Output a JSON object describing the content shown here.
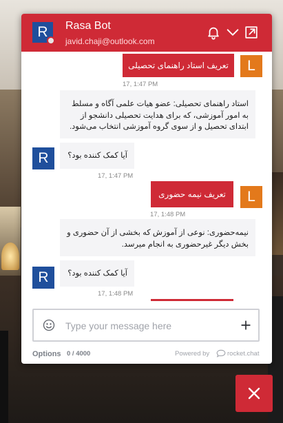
{
  "header": {
    "avatar_letter": "R",
    "title": "Rasa Bot",
    "subtitle": "javid.chaji@outlook.com"
  },
  "messages": [
    {
      "sender": "user",
      "avatar_letter": "L",
      "text": "تعریف استاد راهنمای تحصیلی",
      "time": "17, 1:47 PM"
    },
    {
      "sender": "bot",
      "text": "استاد راهنمای تحصیلی: عضو هیات علمی آگاه و مسلط به امور آموزشی، که برای هدایت تحصیلی دانشجو از ابتدای تحصیل و از سوی گروه آموزشی انتخاب می‌شود."
    },
    {
      "sender": "bot",
      "avatar_letter": "R",
      "text": "آیا کمک کننده بود؟",
      "time": "17, 1:47 PM"
    },
    {
      "sender": "user",
      "avatar_letter": "L",
      "text": "تعریف نیمه حضوری",
      "time": "17, 1:48 PM"
    },
    {
      "sender": "bot",
      "text": "نیمه‌حضوری: نوعی از آموزش که بخشی از آن حضوری و بخش دیگر غیرحضوری به انجام میرسد."
    },
    {
      "sender": "bot",
      "avatar_letter": "R",
      "text": "آیا کمک کننده بود؟",
      "time": "17, 1:48 PM"
    }
  ],
  "composer": {
    "placeholder": "Type your message here"
  },
  "footer": {
    "options_label": "Options",
    "char_count": "0 / 4000",
    "powered_by": "Powered by",
    "brand": "rocket.chat"
  },
  "colors": {
    "brand": "#cf2a36",
    "bot_avatar": "#1f4f9c",
    "user_avatar": "#e3791b",
    "bot_bubble": "#f4f4f6"
  },
  "icons": [
    "bell-icon",
    "chevron-down-icon",
    "popout-icon",
    "emoji-icon",
    "plus-icon",
    "close-icon"
  ]
}
